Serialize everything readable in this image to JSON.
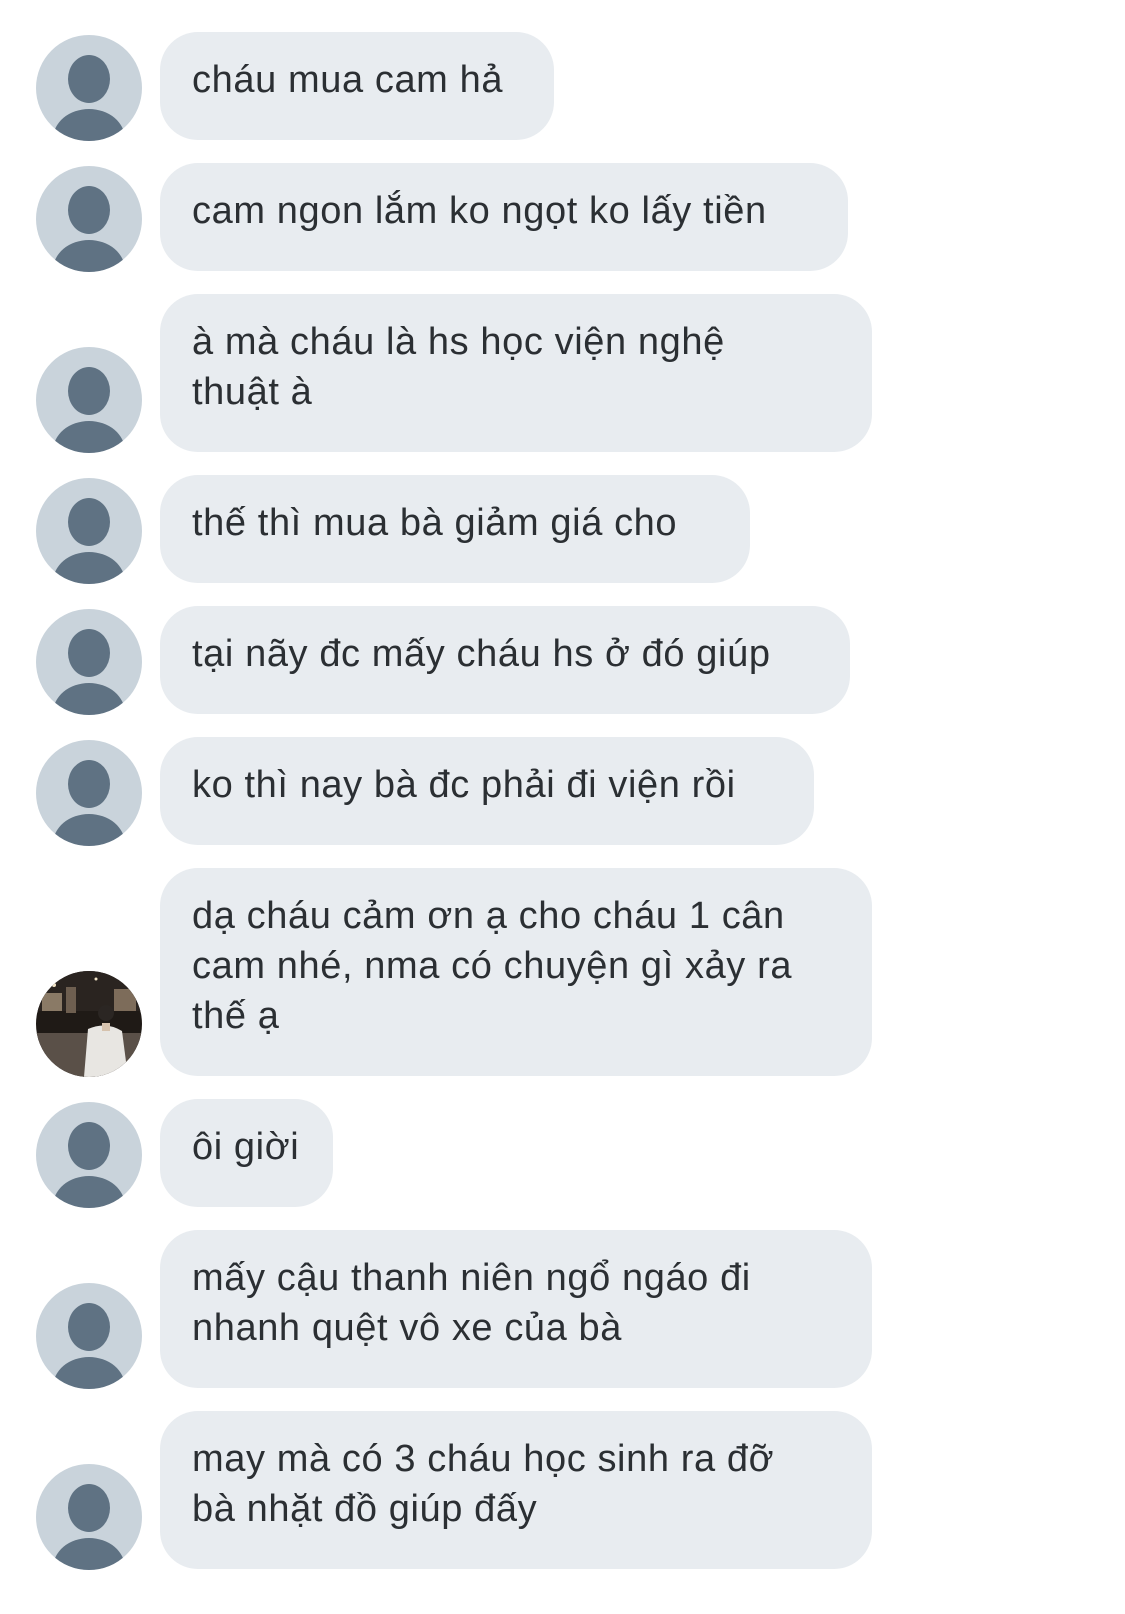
{
  "messages": [
    {
      "sender": "contact",
      "avatar": "default-person-icon",
      "lines": [
        "cháu mua cam hả"
      ]
    },
    {
      "sender": "contact",
      "avatar": "default-person-icon",
      "lines": [
        "cam ngon lắm ko ngọt ko lấy tiền"
      ]
    },
    {
      "sender": "contact",
      "avatar": "default-person-icon",
      "lines": [
        "à mà cháu là hs học viện nghệ",
        "thuật à"
      ]
    },
    {
      "sender": "contact",
      "avatar": "default-person-icon",
      "lines": [
        "thế thì mua bà giảm giá cho"
      ]
    },
    {
      "sender": "contact",
      "avatar": "default-person-icon",
      "lines": [
        "tại nãy đc mấy cháu hs ở đó giúp"
      ]
    },
    {
      "sender": "contact",
      "avatar": "default-person-icon",
      "lines": [
        "ko thì nay bà đc phải đi viện rồi"
      ]
    },
    {
      "sender": "user",
      "avatar": "user-photo-avatar",
      "lines": [
        "dạ cháu cảm ơn ạ cho cháu 1 cân",
        "cam nhé, nma có chuyện gì xảy ra",
        "thế ạ"
      ]
    },
    {
      "sender": "contact",
      "avatar": "default-person-icon",
      "lines": [
        "ôi giời"
      ]
    },
    {
      "sender": "contact",
      "avatar": "default-person-icon",
      "lines": [
        "mấy cậu thanh niên ngổ ngáo đi",
        "nhanh quệt vô xe của bà"
      ]
    },
    {
      "sender": "contact",
      "avatar": "default-person-icon",
      "lines": [
        "may mà có 3 cháu học sinh ra đỡ",
        "bà nhặt đồ giúp đấy"
      ]
    }
  ],
  "colors": {
    "bubble_background": "#e8ecf0",
    "text": "#2b2f33",
    "avatar_background": "#c9d3db",
    "avatar_figure": "#5f7283"
  }
}
